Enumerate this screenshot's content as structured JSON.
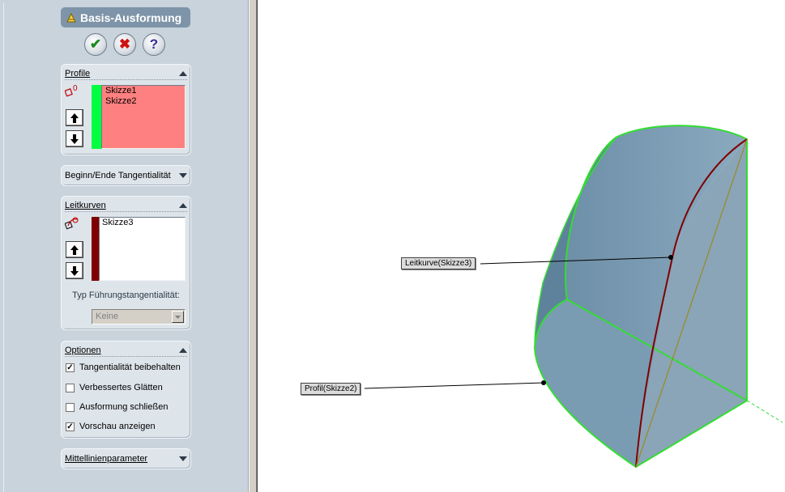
{
  "feature_manager": {
    "title": "Basis-Ausformung",
    "title_icon": "loft-feature-icon",
    "buttons": {
      "ok": "✔",
      "cancel": "✖",
      "help": "?"
    },
    "profile_group": {
      "title": "Profile",
      "items": [
        "Skizze1",
        "Skizze2"
      ],
      "list_bg": "#ff8080",
      "color_bar": "#00ff40",
      "selector_icon": "profile-selection-icon"
    },
    "tangency_group": {
      "title": "Beginn/Ende Tangentialität"
    },
    "guide_group": {
      "title": "Leitkurven",
      "items": [
        "Skizze3"
      ],
      "color_bar": "#800000",
      "selector_icon": "guide-curve-selection-icon",
      "tangency_type_label": "Typ Führungstangentialität:",
      "tangency_type_value": "Keine"
    },
    "options_group": {
      "title": "Optionen",
      "options": [
        {
          "label": "Tangentialität beibehalten",
          "checked": true
        },
        {
          "label": "Verbessertes Glätten",
          "checked": false
        },
        {
          "label": "Ausformung schließen",
          "checked": false
        },
        {
          "label": "Vorschau anzeigen",
          "checked": true
        }
      ]
    },
    "centerline_group": {
      "title": "Mittellinienparameter"
    }
  },
  "viewport": {
    "callouts": {
      "guide": "Leitkurve(Skizze3)",
      "profile": "Profil(Skizze2)"
    },
    "colors": {
      "body_fill": "#7c9db4",
      "edge_highlight": "#33dd33",
      "guide_curve": "#800000",
      "inner_line": "#9a8a20"
    }
  }
}
